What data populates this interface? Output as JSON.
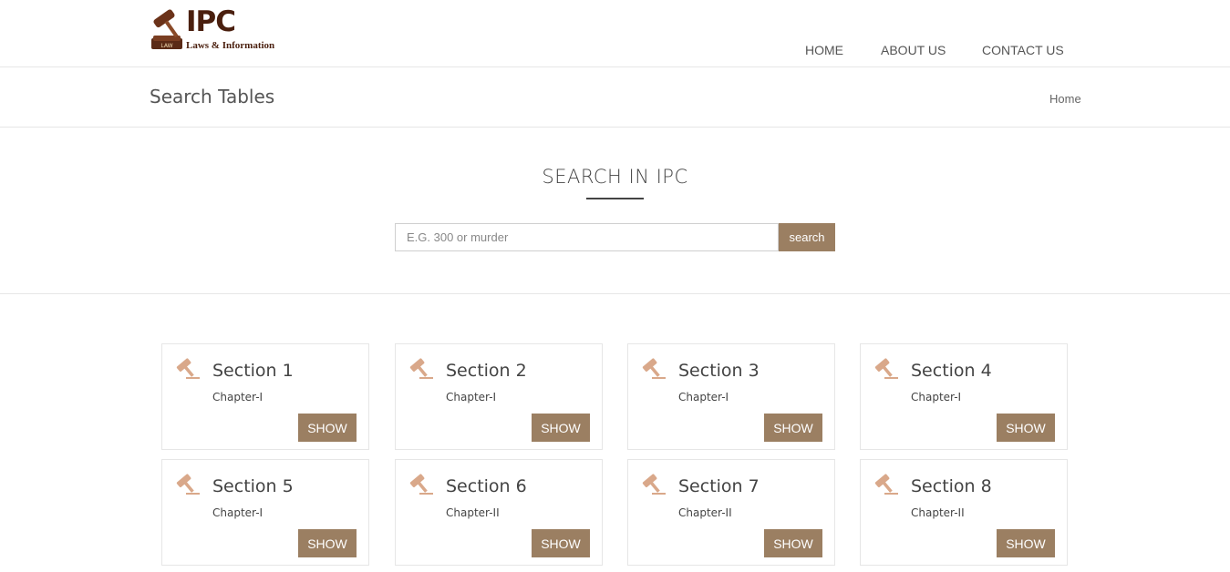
{
  "header": {
    "logo_title": "IPC",
    "logo_subtitle": "Laws & Information",
    "logo_badge": "LAW",
    "nav": [
      {
        "label": "HOME"
      },
      {
        "label": "ABOUT US"
      },
      {
        "label": "CONTACT US"
      }
    ]
  },
  "titlebar": {
    "title": "Search Tables",
    "breadcrumb": "Home"
  },
  "search": {
    "heading": "SEARCH IN IPC",
    "placeholder": "E.G. 300 or murder",
    "button_label": "search"
  },
  "cards": [
    {
      "section": "Section 1",
      "chapter": "Chapter-I",
      "button": "SHOW"
    },
    {
      "section": "Section 2",
      "chapter": "Chapter-I",
      "button": "SHOW"
    },
    {
      "section": "Section 3",
      "chapter": "Chapter-I",
      "button": "SHOW"
    },
    {
      "section": "Section 4",
      "chapter": "Chapter-I",
      "button": "SHOW"
    },
    {
      "section": "Section 5",
      "chapter": "Chapter-I",
      "button": "SHOW"
    },
    {
      "section": "Section 6",
      "chapter": "Chapter-II",
      "button": "SHOW"
    },
    {
      "section": "Section 7",
      "chapter": "Chapter-II",
      "button": "SHOW"
    },
    {
      "section": "Section 8",
      "chapter": "Chapter-II",
      "button": "SHOW"
    }
  ],
  "colors": {
    "accent": "#9b7f62",
    "gavel": "#d9a88a",
    "logo_brown": "#4a1f0e"
  },
  "icons": {
    "card_icon": "gavel-icon",
    "logo_icon": "gavel-logo-icon"
  }
}
